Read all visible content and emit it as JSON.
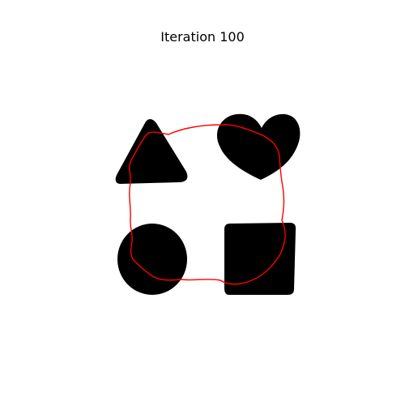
{
  "figure": {
    "title": "Iteration 100"
  },
  "colors": {
    "background": "#ffffff",
    "shape_fill": "#000000",
    "contour": "#ff0000"
  },
  "shapes": [
    {
      "name": "triangle"
    },
    {
      "name": "heart"
    },
    {
      "name": "circle"
    },
    {
      "name": "square"
    }
  ]
}
